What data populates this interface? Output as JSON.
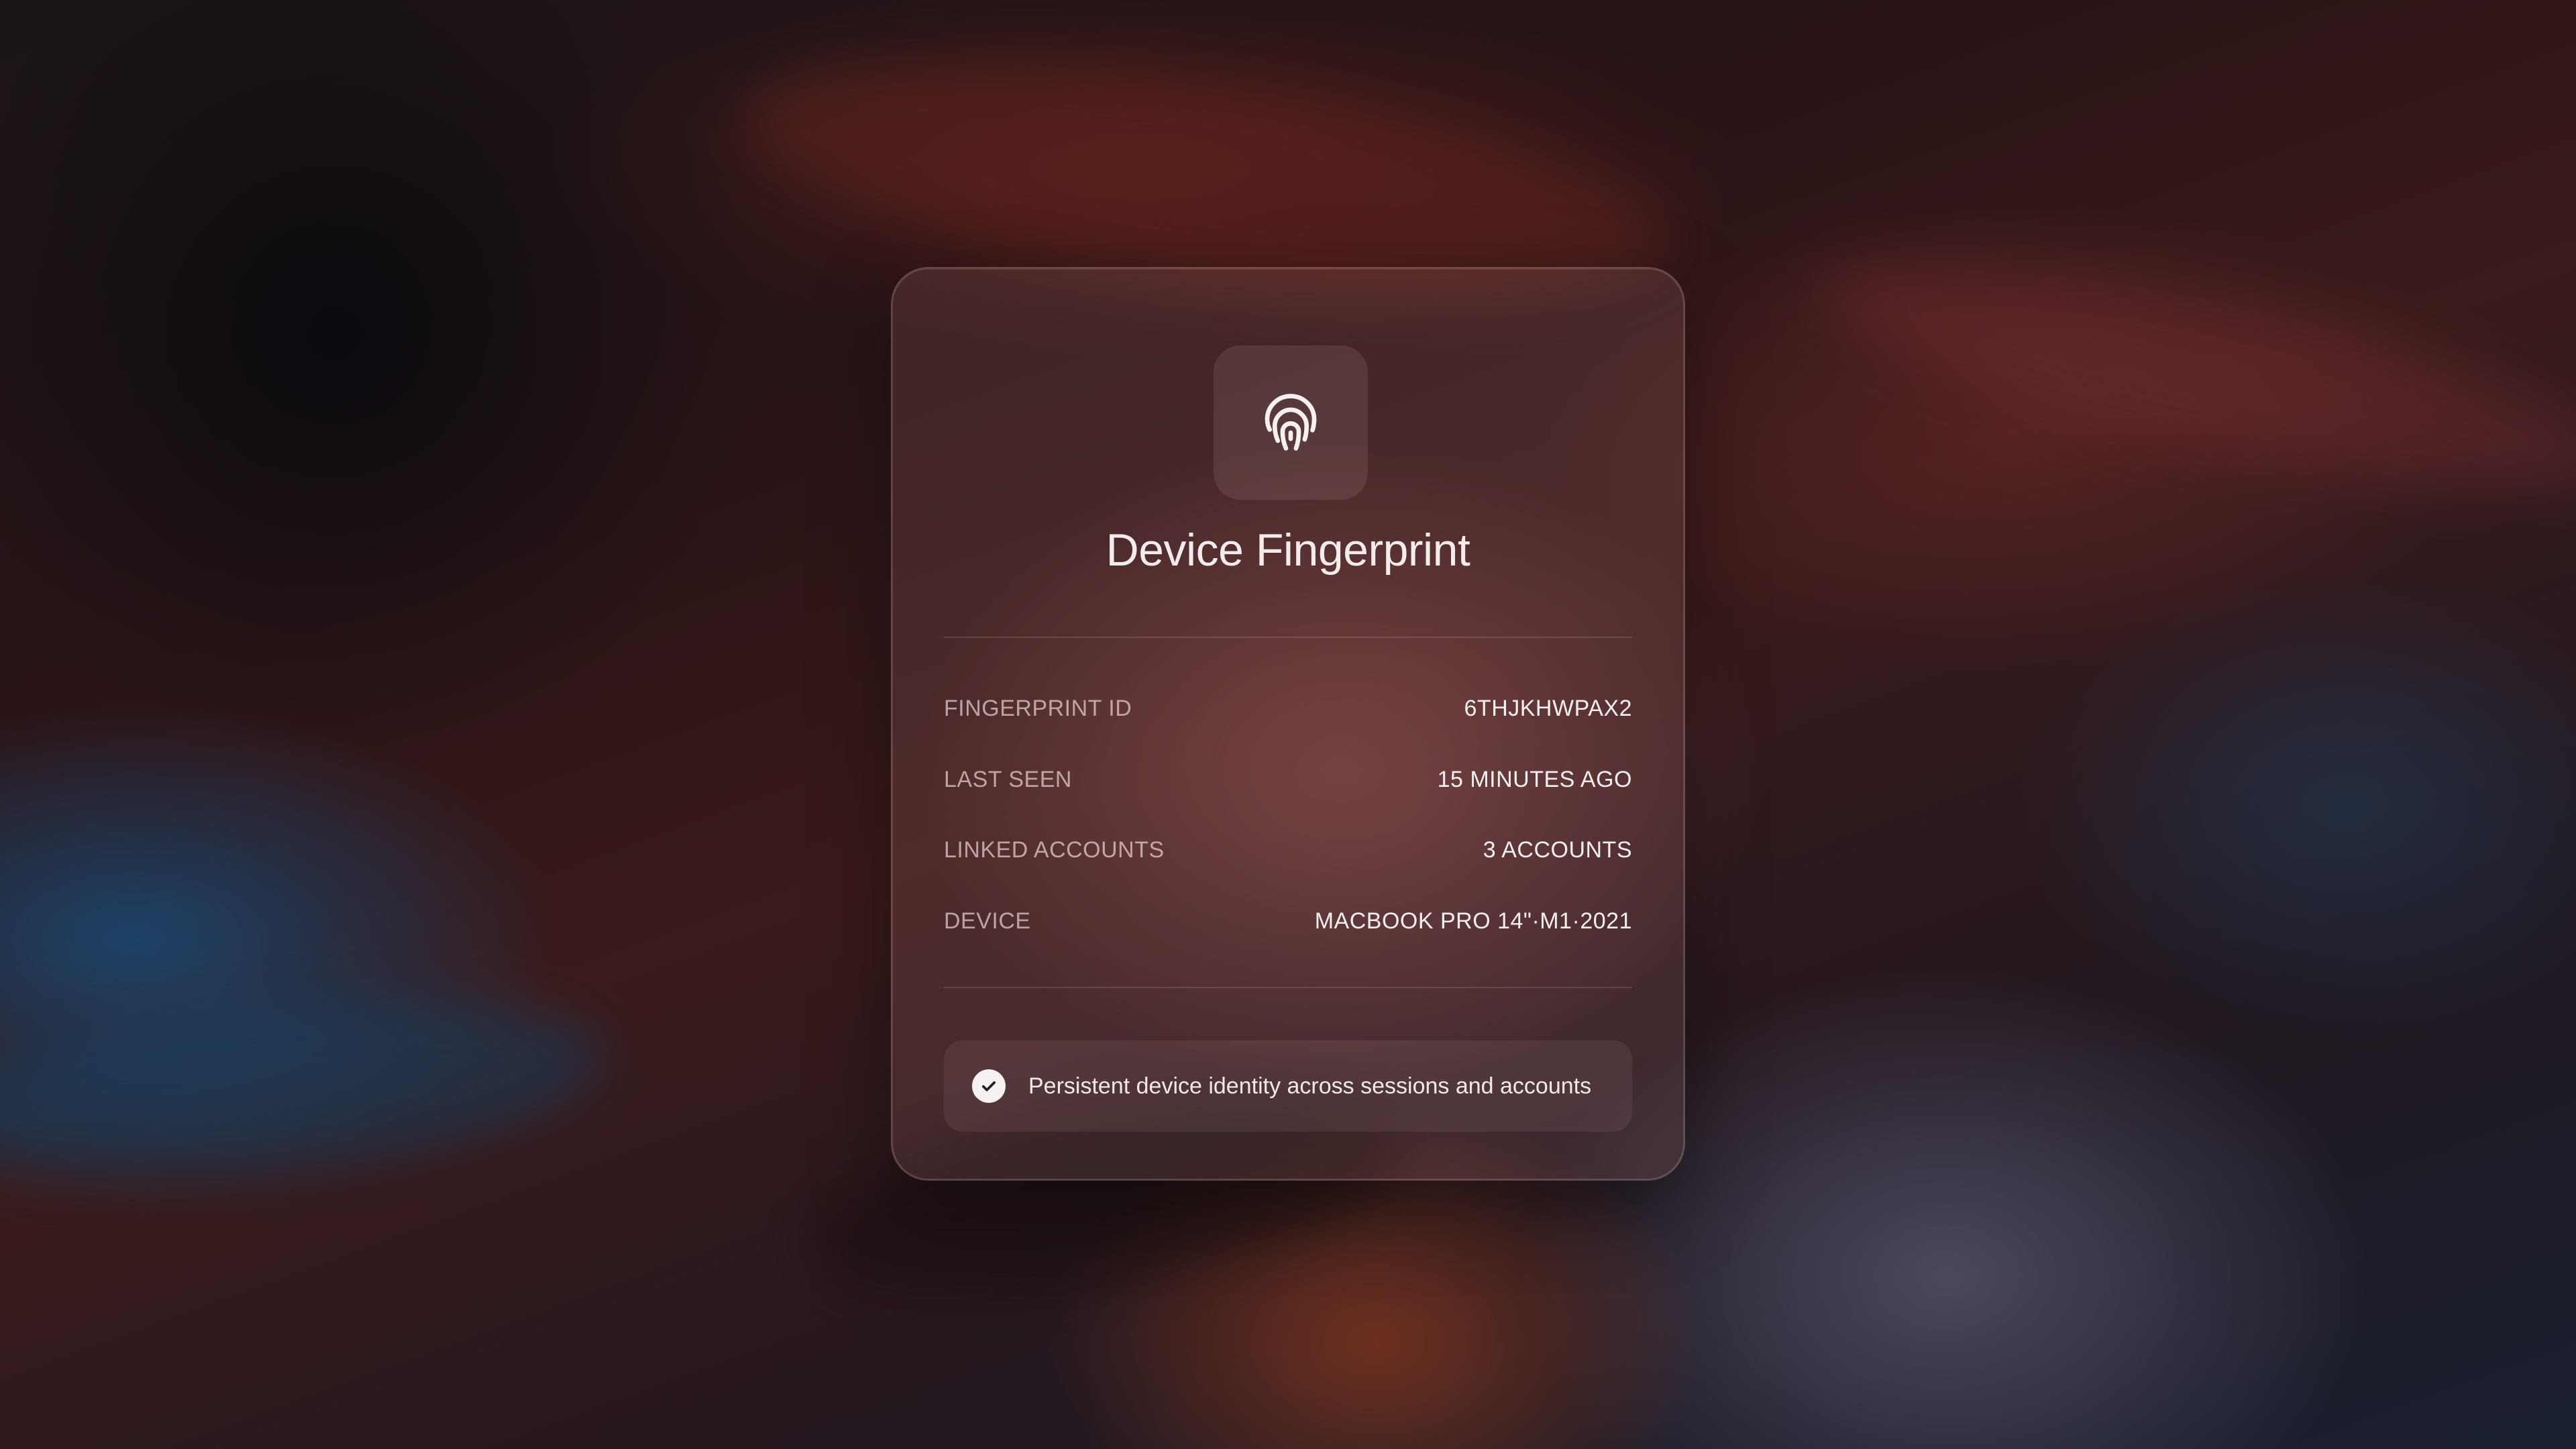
{
  "card": {
    "icon": "fingerprint-icon",
    "title": "Device Fingerprint",
    "details": [
      {
        "label": "FINGERPRINT ID",
        "value": "6THJKHWPAX2"
      },
      {
        "label": "LAST SEEN",
        "value": "15 MINUTES AGO"
      },
      {
        "label": "LINKED ACCOUNTS",
        "value": "3 ACCOUNTS"
      },
      {
        "label": "DEVICE",
        "value": "MACBOOK PRO 14\"·M1·2021"
      }
    ],
    "note": {
      "icon": "check-circle-icon",
      "text": "Persistent device identity across sessions and accounts"
    }
  },
  "colors": {
    "card_tint": "#a06e6e",
    "text_primary": "#f5efef",
    "text_secondary": "#d8c4c4"
  }
}
